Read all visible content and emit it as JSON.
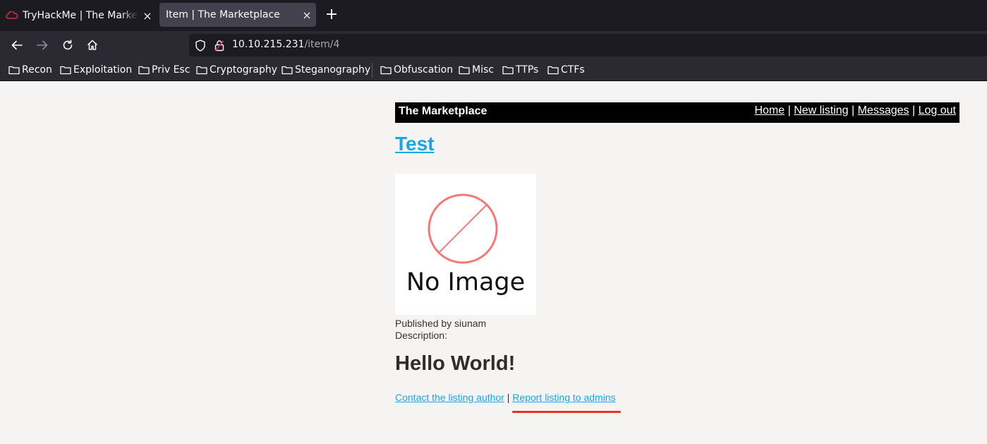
{
  "browser": {
    "tabs": [
      {
        "title": "TryHackMe | The Marketplace",
        "active": false
      },
      {
        "title": "Item | The Marketplace",
        "active": true
      }
    ],
    "close_glyph": "×",
    "new_tab_glyph": "+",
    "url_host": "10.10.215.231",
    "url_path": "/item/4",
    "bookmarks": [
      "Recon",
      "Exploitation",
      "Priv Esc",
      "Cryptography",
      "Steganography",
      "Obfuscation",
      "Misc",
      "TTPs",
      "CTFs"
    ]
  },
  "site": {
    "brand": "The Marketplace",
    "nav": {
      "home": "Home",
      "new_listing": "New listing",
      "messages": "Messages",
      "logout": "Log out",
      "separator": "|"
    }
  },
  "item": {
    "title": "Test",
    "image_placeholder": "No Image",
    "published_by": "Published by siunam",
    "description_label": "Description:",
    "description": "Hello World!",
    "contact_link": "Contact the listing author",
    "separator": "|",
    "report_link": "Report listing to admins"
  },
  "colors": {
    "link": "#1aa5e3",
    "annotation_underline": "#e8361b",
    "header_bg": "#000000"
  }
}
